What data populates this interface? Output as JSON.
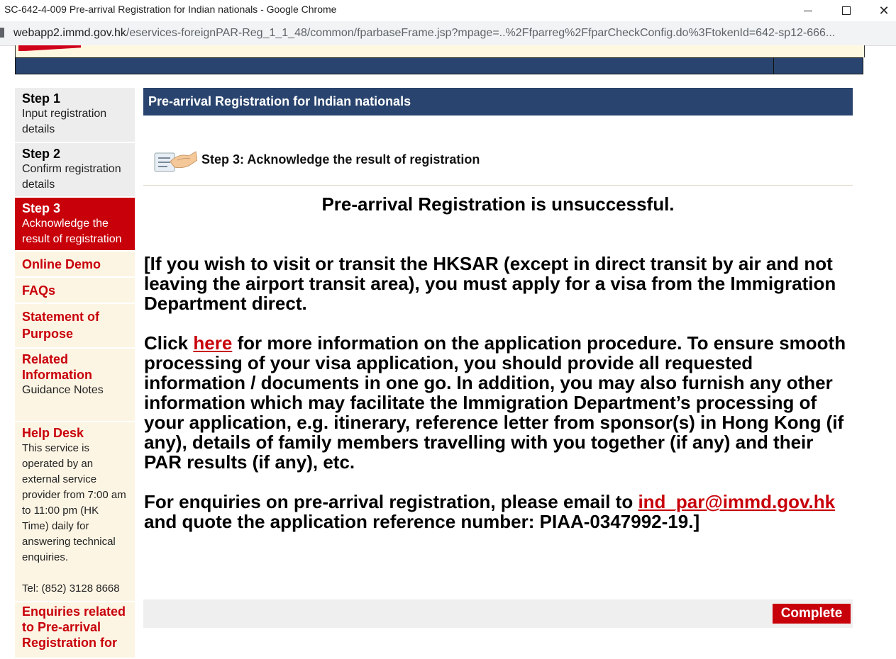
{
  "window": {
    "title": "SC-642-4-009 Pre-arrival Registration for Indian nationals - Google Chrome"
  },
  "address": {
    "domain": "webapp2.immd.gov.hk",
    "path": "/eservices-foreignPAR-Reg_1_1_48/common/fparbaseFrame.jsp?mpage=..%2Ffparreg%2FfparCheckConfig.do%3FtokenId=642-sp12-666..."
  },
  "sidebar": {
    "steps": [
      {
        "title": "Step 1",
        "desc": "Input registration details"
      },
      {
        "title": "Step 2",
        "desc": "Confirm registration details"
      },
      {
        "title": "Step 3",
        "desc": "Acknowledge the result of registration"
      }
    ],
    "online_demo": "Online Demo",
    "faqs": "FAQs",
    "statement": "Statement of Purpose",
    "related_title": "Related Information",
    "related_link": "Guidance Notes",
    "help_title": "Help Desk",
    "help_text": "This service is operated by an external service provider from 7:00 am to 11:00 pm (HK Time) daily for answering technical enquiries.",
    "help_tel": "Tel: (852) 3128 8668",
    "enquiries": "Enquiries related to Pre-arrival Registration for"
  },
  "main": {
    "title": "Pre-arrival Registration for Indian nationals",
    "step_label": "Step 3: Acknowledge the result of registration",
    "result": "Pre-arrival Registration is unsuccessful.",
    "para1": "[If you wish to visit or transit the HKSAR (except in direct transit by air and not leaving the airport transit area), you must apply for a visa from the Immigration Department direct.",
    "para2_pre": "Click ",
    "para2_link": "here",
    "para2_post": " for more information on the application procedure. To ensure smooth processing of your visa application, you should provide all requested information / documents in one go. In addition, you may also furnish any other information which may facilitate the Immigration Department’s processing of your application, e.g. itinerary, reference letter from sponsor(s) in Hong Kong (if any), details of family members travelling with you together (if any) and their PAR results (if any), etc.",
    "para3_pre": "For enquiries on pre-arrival registration, please email to ",
    "para3_email": "ind_par@immd.gov.hk",
    "para3_post": " and quote the application reference number: PIAA-0347992-19.]",
    "complete_label": "Complete"
  }
}
